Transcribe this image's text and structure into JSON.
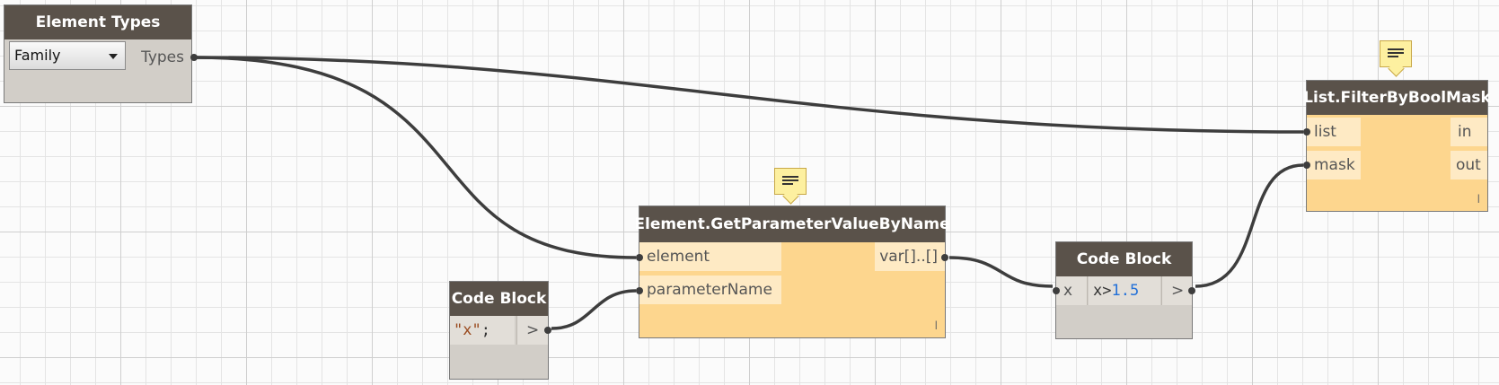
{
  "element_types": {
    "title": "Element Types",
    "dropdown_value": "Family",
    "output_port": "Types"
  },
  "get_parameter": {
    "title": "Element.GetParameterValueByName",
    "input_ports": [
      "element",
      "parameterName"
    ],
    "output_port": "var[]..[]",
    "lacing": "l"
  },
  "code_block_1": {
    "title": "Code Block",
    "string_literal": "\"x\"",
    "terminator": ";",
    "output_port": ">"
  },
  "code_block_2": {
    "title": "Code Block",
    "input_port": "x",
    "code_prefix": "x>",
    "code_number": "1.5",
    "code_suffix": ";",
    "output_port": ">"
  },
  "filter": {
    "title": "List.FilterByBoolMask",
    "input_ports": [
      "list",
      "mask"
    ],
    "output_ports": [
      "in",
      "out"
    ],
    "lacing": "l"
  },
  "colors": {
    "header": "#5a524a",
    "node_body_gray": "#d2cec8",
    "node_body_yellow": "#fdd68e",
    "wire": "#3d3d3d",
    "code_string": "#9a4a1e",
    "code_number": "#2270d8"
  }
}
